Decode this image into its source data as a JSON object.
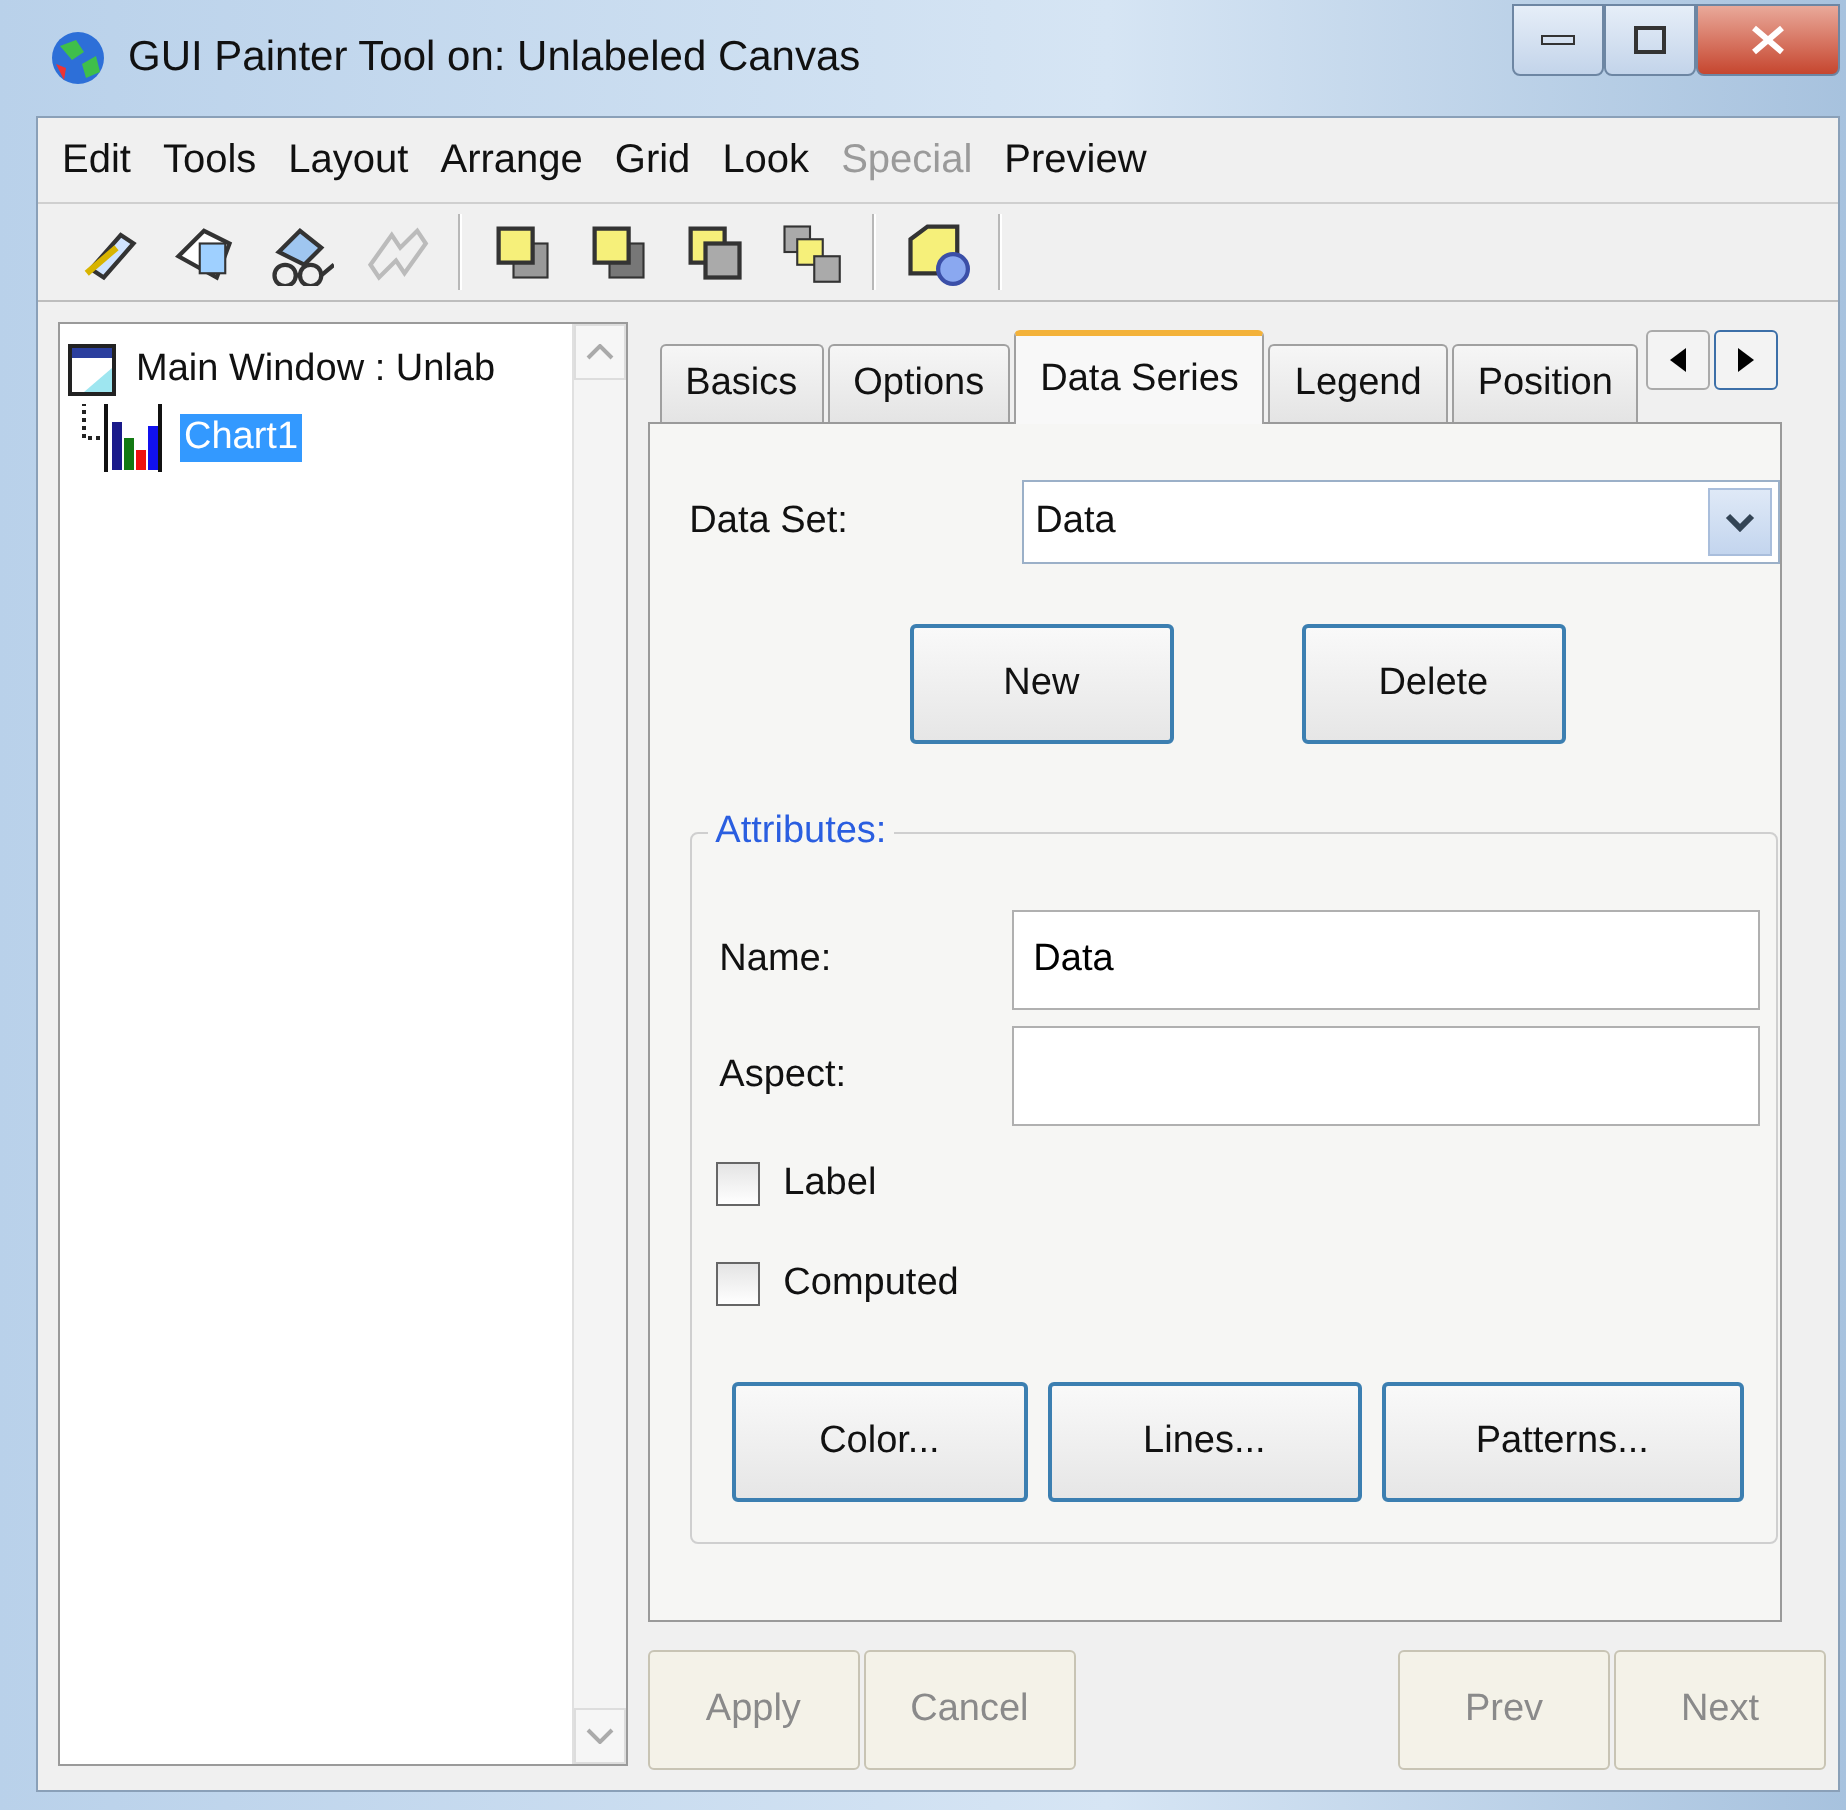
{
  "window": {
    "title": "GUI Painter Tool on: Unlabeled Canvas"
  },
  "menu": [
    {
      "label": "Edit",
      "disabled": false
    },
    {
      "label": "Tools",
      "disabled": false
    },
    {
      "label": "Layout",
      "disabled": false
    },
    {
      "label": "Arrange",
      "disabled": false
    },
    {
      "label": "Grid",
      "disabled": false
    },
    {
      "label": "Look",
      "disabled": false
    },
    {
      "label": "Special",
      "disabled": true
    },
    {
      "label": "Preview",
      "disabled": false
    }
  ],
  "toolbar": [
    {
      "kind": "edit",
      "disabled": false
    },
    {
      "kind": "shape",
      "disabled": false
    },
    {
      "kind": "glasses",
      "disabled": false
    },
    {
      "kind": "bolt",
      "disabled": true
    },
    {
      "kind": "sep"
    },
    {
      "kind": "front",
      "disabled": false
    },
    {
      "kind": "back",
      "disabled": false
    },
    {
      "kind": "forward",
      "disabled": false
    },
    {
      "kind": "backward",
      "disabled": false
    },
    {
      "kind": "sep"
    },
    {
      "kind": "cube",
      "disabled": false
    },
    {
      "kind": "sep"
    }
  ],
  "tree": [
    {
      "label": "Main Window : Unlab",
      "kind": "window",
      "selected": false,
      "children": [
        {
          "label": "Chart1",
          "kind": "chart",
          "selected": true
        }
      ]
    }
  ],
  "tabs": [
    {
      "label": "Basics",
      "selected": false
    },
    {
      "label": "Options",
      "selected": false
    },
    {
      "label": "Data Series",
      "selected": true
    },
    {
      "label": "Legend",
      "selected": false
    },
    {
      "label": "Position",
      "selected": false
    }
  ],
  "data_set": {
    "label": "Data Set:",
    "value": "Data"
  },
  "set_buttons": [
    "New",
    "Delete"
  ],
  "attributes": {
    "legend": "Attributes:",
    "fields": [
      {
        "label": "Name:",
        "value": "Data"
      },
      {
        "label": "Aspect:"
      }
    ],
    "checkboxes": [
      {
        "label": "Label",
        "checked": false
      },
      {
        "label": "Computed",
        "checked": false
      }
    ],
    "buttons": [
      "Color...",
      "Lines...",
      "Patterns..."
    ]
  },
  "footer_buttons": [
    {
      "label": "Apply",
      "disabled": true
    },
    {
      "label": "Cancel",
      "disabled": true
    },
    {
      "label": "Prev",
      "disabled": true
    },
    {
      "label": "Next",
      "disabled": true
    }
  ]
}
